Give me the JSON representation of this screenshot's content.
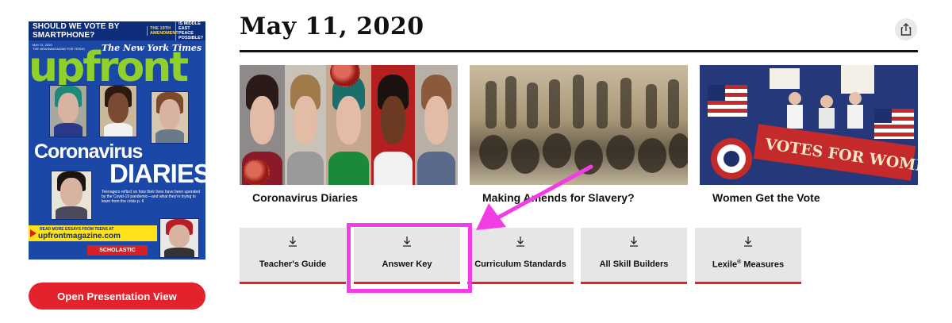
{
  "cover": {
    "headline_question": "SHOULD WE VOTE BY SMARTPHONE?",
    "side_1": "THE 19TH AMENDMENT",
    "side_2": "IS MIDDLE EAST PEACE POSSIBLE?",
    "meta_line_1": "MAY 11, 2020",
    "meta_line_2": "THE NEWSMAGAZINE FOR TEENS",
    "masthead": "The New York Times",
    "logo": "upfront",
    "title_line_1": "Coronavirus",
    "title_line_2": "DIARIES",
    "blurb": "Teenagers reflect on how their lives have been upended by the Covid-19 pandemic—and what they're trying to learn from the crisis p. 6",
    "banner_line_1": "READ MORE ESSAYS FROM TEENS AT",
    "banner_line_2": "upfrontmagazine.com",
    "publisher": "SCHOLASTIC"
  },
  "present_button_label": "Open Presentation View",
  "issue_date": "May 11, 2020",
  "articles": [
    {
      "title": "Coronavirus Diaries"
    },
    {
      "title": "Making Amends for Slavery?"
    },
    {
      "title": "Women Get the Vote"
    }
  ],
  "article_3_sign": "VOTES FOR WOMEN",
  "resources": [
    {
      "label": "Teacher's Guide"
    },
    {
      "label": "Answer Key"
    },
    {
      "label": "Curriculum Standards"
    },
    {
      "label": "All Skill Builders"
    },
    {
      "label_main": "Lexile",
      "label_reg": "®",
      "label_tail": " Measures"
    }
  ],
  "colors": {
    "accent_red": "#e2232e",
    "highlight_magenta": "#f23de4",
    "cover_blue": "#1b47a6",
    "logo_green": "#8fd12a"
  }
}
